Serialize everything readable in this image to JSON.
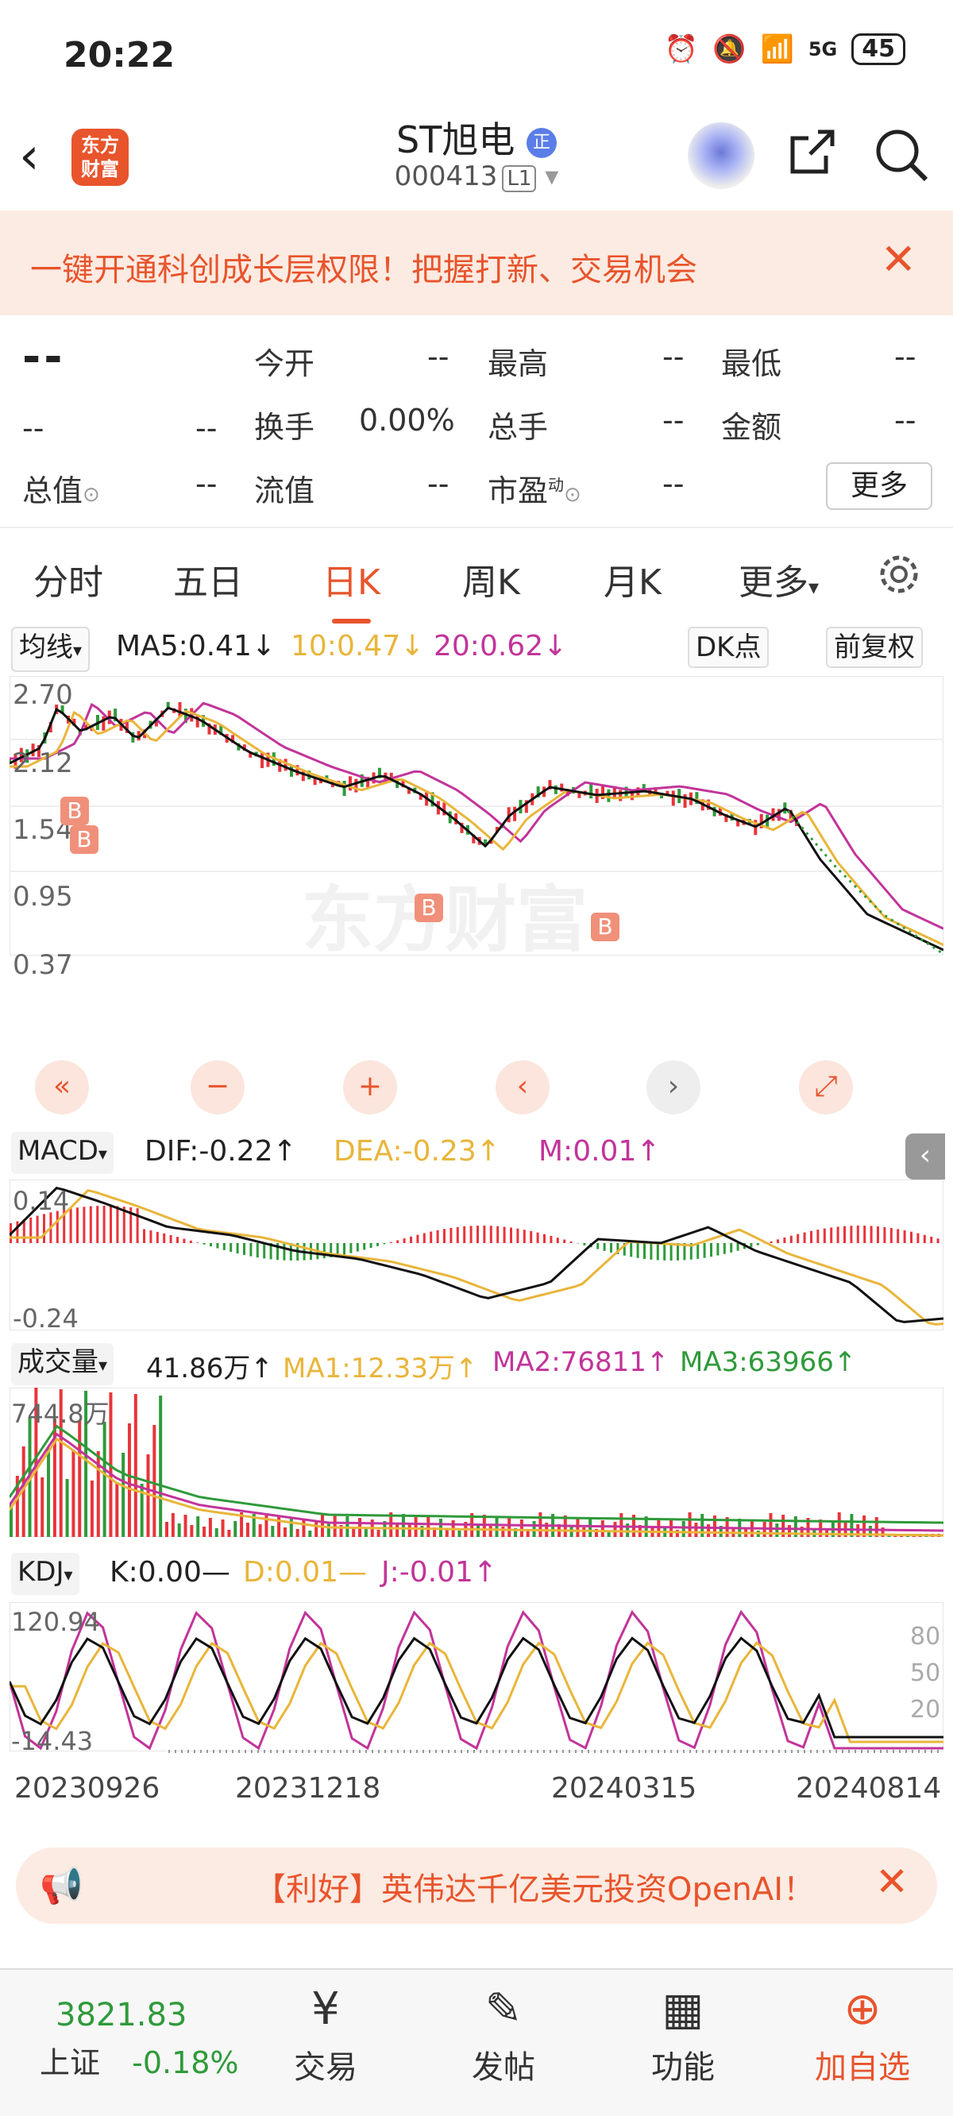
{
  "status": {
    "time": "20:22",
    "battery": "45",
    "net": "5G"
  },
  "header": {
    "logo": "东方财富",
    "title": "ST旭电",
    "title_badge": "正",
    "code": "000413",
    "level": "L1"
  },
  "banner": {
    "text": "一键开通科创成长层权限！把握打新、交易机会"
  },
  "quote": {
    "price": "--",
    "change": "--",
    "change_pct": "--",
    "open_label": "今开",
    "open": "--",
    "high_label": "最高",
    "high": "--",
    "low_label": "最低",
    "low": "--",
    "turnover_label": "换手",
    "turnover": "0.00%",
    "volume_label": "总手",
    "volume": "--",
    "amount_label": "金额",
    "amount": "--",
    "mktcap_label": "总值",
    "mktcap": "--",
    "float_label": "流值",
    "float": "--",
    "pe_label": "市盈",
    "pe_sup": "动",
    "pe": "--",
    "more": "更多"
  },
  "tabs": [
    "分时",
    "五日",
    "日K",
    "周K",
    "月K",
    "更多"
  ],
  "kline": {
    "ma_selector": "均线",
    "ma5": "MA5:0.41",
    "ma10": "10:0.47",
    "ma20": "20:0.62",
    "dk": "DK点",
    "fq": "前复权",
    "y_ticks": [
      "2.70",
      "2.12",
      "1.54",
      "0.95",
      "0.37"
    ],
    "watermark": "东方财富",
    "b_marker": "B"
  },
  "macd": {
    "selector": "MACD",
    "dif": "DIF:-0.22",
    "dea": "DEA:-0.23",
    "m": "M:0.01",
    "y_top": "0.14",
    "y_bottom": "-0.24"
  },
  "volume": {
    "selector": "成交量",
    "vol": "41.86万",
    "ma1": "MA1:12.33万",
    "ma2": "MA2:76811",
    "ma3": "MA3:63966",
    "y_top": "744.8万"
  },
  "kdj": {
    "selector": "KDJ",
    "k": "K:0.00",
    "d": "D:0.01",
    "j": "J:-0.01",
    "y_top": "120.94",
    "y_bottom": "-14.43",
    "levels": [
      "80",
      "50",
      "20"
    ]
  },
  "dates": [
    "20230926",
    "20231218",
    "20240315",
    "20240814"
  ],
  "news": {
    "text": "【利好】英伟达千亿美元投资OpenAI！"
  },
  "nav": {
    "index_value": "3821.83",
    "index_name": "上证",
    "index_pct": "-0.18%",
    "trade": "交易",
    "post": "发帖",
    "func": "功能",
    "add": "加自选"
  },
  "colors": {
    "accent": "#e8542c",
    "up": "#e8343a",
    "down": "#2f9a3a",
    "ma10": "#e9b53a",
    "ma20": "#c2349a"
  }
}
